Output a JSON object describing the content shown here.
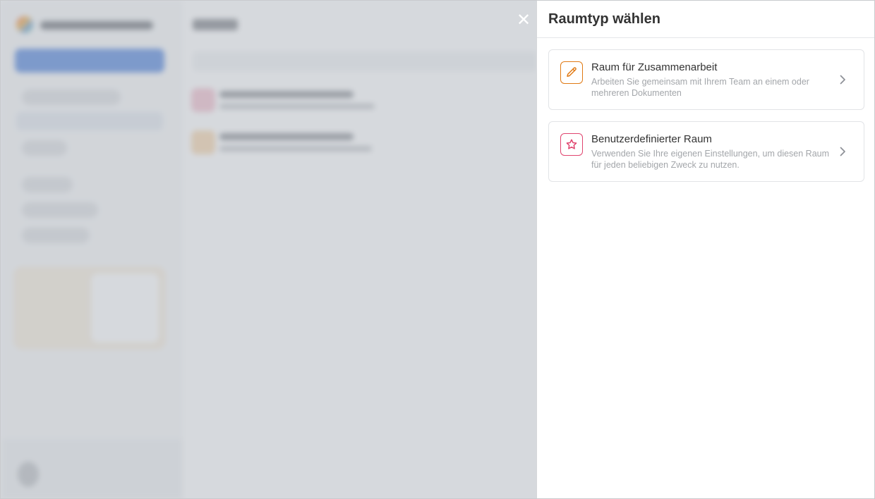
{
  "panel": {
    "title": "Raumtyp wählen",
    "close_icon": "close-icon",
    "options": [
      {
        "title": "Raum für Zusammenarbeit",
        "description": "Arbeiten Sie gemeinsam mit Ihrem Team an einem oder mehreren Dokumenten",
        "icon": "pencil-icon",
        "color": "#e07a14"
      },
      {
        "title": "Benutzerdefinierter Raum",
        "description": "Verwenden Sie Ihre eigenen Einstellungen, um diesen Raum für jeden beliebigen Zweck zu nutzen.",
        "icon": "star-icon",
        "color": "#e0456f"
      }
    ]
  },
  "colors": {
    "overlay": "#b5bac1",
    "text_primary": "#333333",
    "text_secondary": "#a3a6aa"
  }
}
